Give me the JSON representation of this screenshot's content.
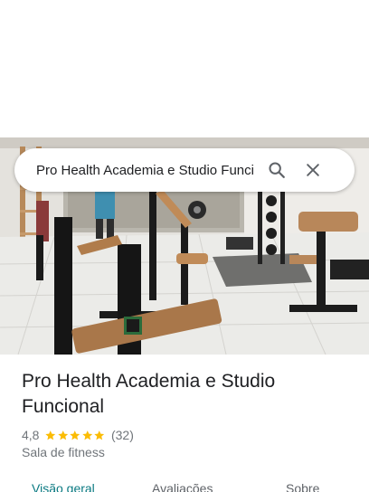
{
  "search": {
    "query": "Pro Health Academia e Studio Funci"
  },
  "place": {
    "name": "Pro Health Academia e Studio Funcional",
    "rating": "4,8",
    "stars": 5,
    "review_count": "(32)",
    "category": "Sala de fitness"
  },
  "tabs": [
    {
      "label": "Visão geral",
      "active": true
    },
    {
      "label": "Avaliações",
      "active": false
    },
    {
      "label": "Sobre",
      "active": false
    }
  ],
  "colors": {
    "accent": "#0b7a82",
    "star": "#fbbc04",
    "text_primary": "#202124",
    "text_secondary": "#70757a"
  },
  "icons": {
    "search": "search-icon",
    "close": "close-icon",
    "star": "star-icon"
  }
}
